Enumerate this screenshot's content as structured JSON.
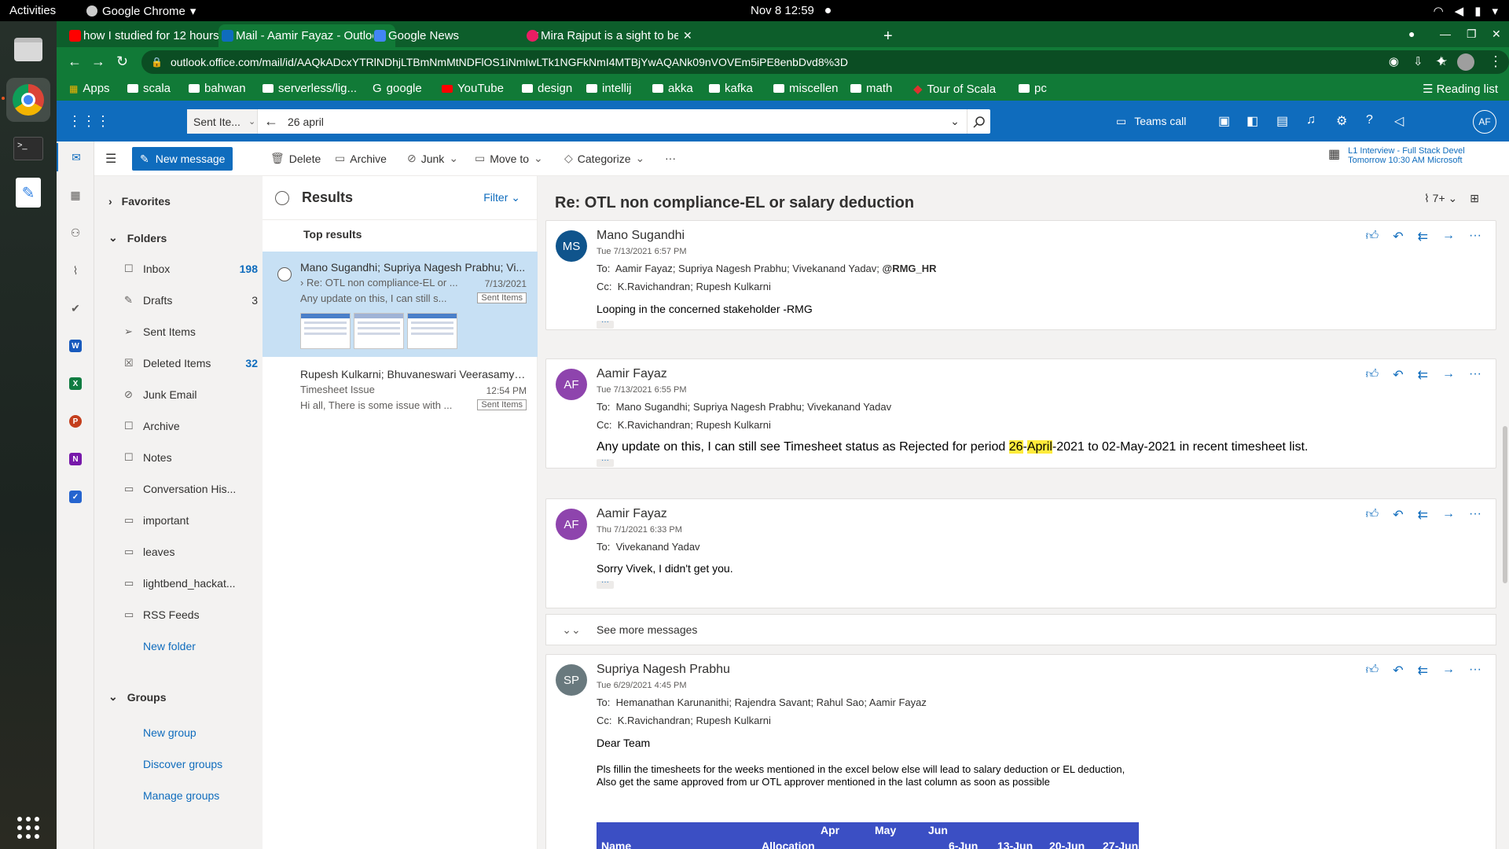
{
  "gnome": {
    "activities": "Activities",
    "app_name": "Google Chrome",
    "clock": "Nov 8  12:59"
  },
  "chrome": {
    "tabs": [
      {
        "title": "how I studied for 12 hours",
        "icon": "youtube-icon",
        "color": "#ff0000"
      },
      {
        "title": "Mail - Aamir Fayaz - Outlook",
        "icon": "outlook-icon",
        "color": "#0f6cbd"
      },
      {
        "title": "Google News",
        "icon": "google-news-icon",
        "color": "#4285f4"
      },
      {
        "title": "Mira Rajput is a sight to be",
        "icon": "pinkvilla-icon",
        "color": "#e91e63"
      }
    ],
    "url": "outlook.office.com/mail/id/AAQkADcxYTRlNDhjLTBmNmMtNDFlOS1iNmIwLTk1NGFkNmI4MTBjYwAQANk09nVOVEm5iPE8enbDvd8%3D",
    "bookmarks": [
      "Apps",
      "scala",
      "bahwan",
      "serverless/lig...",
      "google",
      "YouTube",
      "design",
      "intellij",
      "akka",
      "kafka",
      "miscellen",
      "math",
      "Tour of Scala",
      "pc"
    ],
    "reading_list": "Reading list"
  },
  "header": {
    "search_scope": "Sent Ite...",
    "search_query": "26 april",
    "teams_call": "Teams call",
    "me_initials": "AF"
  },
  "commands": {
    "new_message": "New message",
    "delete": "Delete",
    "archive": "Archive",
    "junk": "Junk",
    "move_to": "Move to",
    "categorize": "Categorize",
    "more": "···",
    "upcoming_title": "L1 Interview - Full Stack Devel",
    "upcoming_time": "Tomorrow 10:30 AM Microsoft"
  },
  "folders": {
    "favorites": "Favorites",
    "folders_label": "Folders",
    "items": [
      {
        "label": "Inbox",
        "count": "198",
        "icon": "☐"
      },
      {
        "label": "Drafts",
        "count": "3",
        "icon": "✎"
      },
      {
        "label": "Sent Items",
        "count": "",
        "icon": "➢"
      },
      {
        "label": "Deleted Items",
        "count": "32",
        "icon": "☒"
      },
      {
        "label": "Junk Email",
        "count": "",
        "icon": "⊘"
      },
      {
        "label": "Archive",
        "count": "",
        "icon": "☐"
      },
      {
        "label": "Notes",
        "count": "",
        "icon": "☐"
      },
      {
        "label": "Conversation His...",
        "count": "",
        "icon": "▭"
      },
      {
        "label": "important",
        "count": "",
        "icon": "▭"
      },
      {
        "label": "leaves",
        "count": "",
        "icon": "▭"
      },
      {
        "label": "lightbend_hackat...",
        "count": "",
        "icon": "▭"
      },
      {
        "label": "RSS Feeds",
        "count": "",
        "icon": "▭"
      }
    ],
    "new_folder": "New folder",
    "groups_label": "Groups",
    "new_group": "New group",
    "discover_groups": "Discover groups",
    "manage_groups": "Manage groups"
  },
  "list": {
    "title": "Results",
    "filter": "Filter",
    "top_results": "Top results",
    "messages": [
      {
        "from": "Mano Sugandhi; Supriya Nagesh Prabhu; Vi...",
        "subject": "Re: OTL non compliance-EL or ...",
        "date": "7/13/2021",
        "preview": "Any update on this, I can still s...",
        "tag": "Sent Items"
      },
      {
        "from": "Rupesh Kulkarni; Bhuvaneswari Veerasamy; ...",
        "subject": "Timesheet Issue",
        "date": "12:54 PM",
        "preview": "Hi all, There is some issue with ...",
        "tag": "Sent Items"
      }
    ]
  },
  "reading": {
    "title": "Re: OTL non compliance-EL or salary deduction",
    "attach_count": "7+",
    "see_more": "See more messages",
    "messages": [
      {
        "initials": "MS",
        "color": "#0f548c",
        "sender": "Mano Sugandhi",
        "date": "Tue 7/13/2021 6:57 PM",
        "to_label": "To:",
        "to": "Aamir Fayaz; Supriya Nagesh Prabhu; Vivekanand Yadav;",
        "to_bold": "@RMG_HR",
        "cc_label": "Cc:",
        "cc": "K.Ravichandran; Rupesh Kulkarni",
        "body": "Looping in the concerned stakeholder -RMG"
      },
      {
        "initials": "AF",
        "color": "#8e44ad",
        "sender": "Aamir Fayaz",
        "date": "Tue 7/13/2021 6:55 PM",
        "to_label": "To:",
        "to": "Mano Sugandhi; Supriya Nagesh Prabhu; Vivekanand Yadav",
        "cc_label": "Cc:",
        "cc": "K.Ravichandran; Rupesh Kulkarni",
        "body_pre": "Any update on this, I can still see Timesheet status as Rejected for period ",
        "body_hl1": "26",
        "body_mid": "-",
        "body_hl2": "April",
        "body_post": "-2021 to 02-May-2021 in recent timesheet list."
      },
      {
        "initials": "AF",
        "color": "#8e44ad",
        "sender": "Aamir Fayaz",
        "date": "Thu 7/1/2021 6:33 PM",
        "to_label": "To:",
        "to": "Vivekanand Yadav",
        "body": "Sorry Vivek, I didn't get you."
      },
      {
        "initials": "SP",
        "color": "#69797e",
        "sender": "Supriya Nagesh Prabhu",
        "date": "Tue 6/29/2021 4:45 PM",
        "to_label": "To:",
        "to": "Hemanathan Karunanithi; Rajendra Savant; Rahul Sao; Aamir Fayaz",
        "cc_label": "Cc:",
        "cc": "K.Ravichandran; Rupesh Kulkarni",
        "greeting": "Dear Team",
        "line1": "Pls fillin the timesheets for the weeks mentioned in the excel below else will lead to salary deduction or EL deduction,",
        "line2": "Also get the same approved from ur OTL approver mentioned in the last column as soon as possible"
      }
    ],
    "table": {
      "name": "Name",
      "allocation": "Allocation",
      "months": [
        "Apr",
        "May",
        "Jun"
      ],
      "weeks": [
        "6-Jun",
        "13-Jun",
        "20-Jun",
        "27-Jun"
      ]
    }
  }
}
